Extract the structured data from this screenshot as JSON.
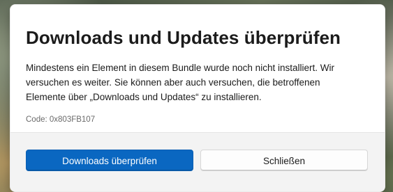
{
  "dialog": {
    "title": "Downloads und Updates überprüfen",
    "message": "Mindestens ein Element in diesem Bundle wurde noch nicht installiert. Wir versuchen es weiter. Sie können aber auch versuchen, die betroffenen Elemente über „Downloads und Updates“ zu installieren.",
    "code": "Code: 0x803FB107"
  },
  "buttons": {
    "primary_label": "Downloads überprüfen",
    "secondary_label": "Schließen"
  },
  "colors": {
    "accent": "#0a67c1",
    "footer_background": "#f3f3f3",
    "dialog_background": "#ffffff"
  }
}
